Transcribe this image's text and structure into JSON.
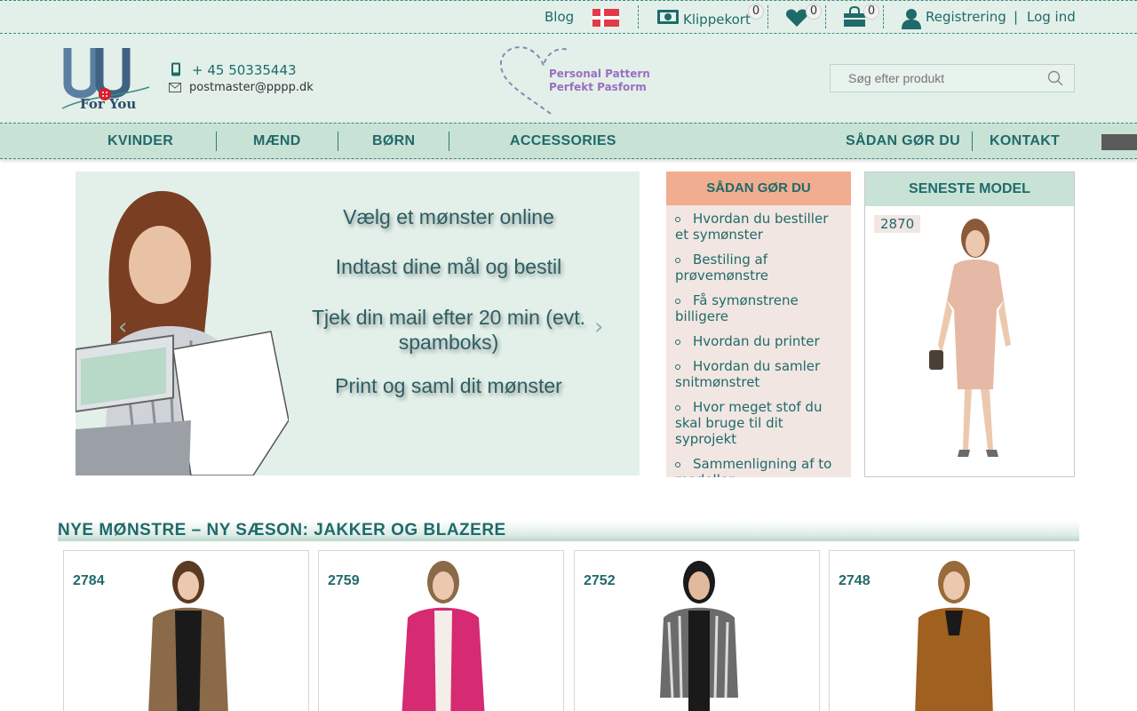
{
  "topbar": {
    "blog": "Blog",
    "klippekort": "Klippekort",
    "klippekort_count": "0",
    "wishlist_count": "0",
    "cart_count": "0",
    "register": "Registrering",
    "divider": "|",
    "login": "Log ind"
  },
  "header": {
    "logo_text": "For You",
    "phone": "+ 45 50335443",
    "email": "postmaster@pppp.dk",
    "tagline_line1": "Personal Pattern",
    "tagline_line2": "Perfekt  Pasform",
    "search_placeholder": "Søg efter produkt"
  },
  "nav": {
    "items": [
      "KVINDER",
      "MÆND",
      "BØRN",
      "ACCESSORIES",
      "SÅDAN GØR DU",
      "KONTAKT"
    ]
  },
  "banner": {
    "lines": [
      "Vælg et mønster online",
      "Indtast dine mål og bestil",
      "Tjek din mail efter 20 min (evt. spamboks)",
      "Print og saml dit mønster"
    ],
    "prev": "‹",
    "next": "›"
  },
  "howto": {
    "title": "SÅDAN GØR DU",
    "items": [
      "Hvordan du bestiller et symønster",
      "Bestiling af prøvemønstre",
      "Få symønstrene billigere",
      "Hvordan du printer",
      "Hvordan du samler snitmønstret",
      "Hvor meget stof du skal bruge til dit syprojekt",
      "Sammenligning af to modeller"
    ]
  },
  "latest": {
    "title": "SENESTE MODEL",
    "model_number": "2870"
  },
  "section": {
    "title": "NYE MØNSTRE – NY SÆSON: JAKKER OG BLAZERE",
    "cards": [
      {
        "number": "2784",
        "jacket_color": "#8a6a48"
      },
      {
        "number": "2759",
        "jacket_color": "#d62a73"
      },
      {
        "number": "2752",
        "jacket_color": "#6b6b6b"
      },
      {
        "number": "2748",
        "jacket_color": "#a0601f"
      }
    ]
  },
  "colors": {
    "accent": "#1f6a6a",
    "header_bg": "#e3f0ea",
    "nav_bg": "#c9e2d6",
    "howto_head": "#f0ad8f",
    "howto_bg": "#f2e6e2"
  }
}
